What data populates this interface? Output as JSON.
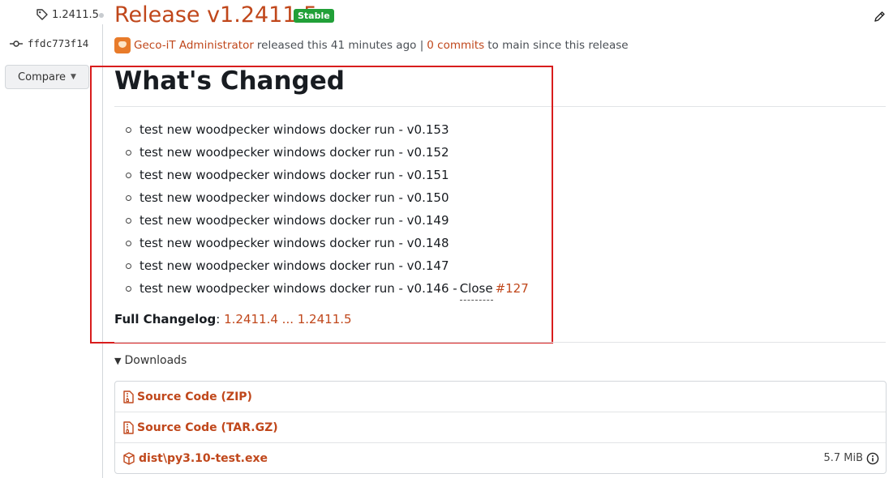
{
  "sidebar": {
    "tag": "1.2411.5",
    "commit": "ffdc773f14",
    "compare_label": "Compare"
  },
  "header": {
    "title": "Release v1.2411.5",
    "badge": "Stable",
    "author": "Geco-iT Administrator",
    "released_text": "released this 41 minutes ago |",
    "commit_count": "0 commits",
    "since_text": "to main since this release"
  },
  "body": {
    "heading": "What's Changed",
    "changes": [
      "test new woodpecker windows docker run - v0.153",
      "test new woodpecker windows docker run - v0.152",
      "test new woodpecker windows docker run - v0.151",
      "test new woodpecker windows docker run - v0.150",
      "test new woodpecker windows docker run - v0.149",
      "test new woodpecker windows docker run - v0.148",
      "test new woodpecker windows docker run - v0.147",
      "test new woodpecker windows docker run - v0.146 -"
    ],
    "close_label": "Close",
    "issue_ref": "#127",
    "full_changelog_label": "Full Changelog",
    "full_changelog_link": "1.2411.4 ... 1.2411.5"
  },
  "downloads": {
    "toggle_label": "Downloads",
    "items": [
      {
        "name": "Source Code (ZIP)",
        "icon": "zip-file-icon",
        "size": ""
      },
      {
        "name": "Source Code (TAR.GZ)",
        "icon": "zip-file-icon",
        "size": ""
      },
      {
        "name": "dist\\py3.10-test.exe",
        "icon": "package-icon",
        "size": "5.7 MiB"
      }
    ]
  },
  "colors": {
    "accent": "#c0471b",
    "badge": "#21a038",
    "highlight": "#d81d1d"
  }
}
